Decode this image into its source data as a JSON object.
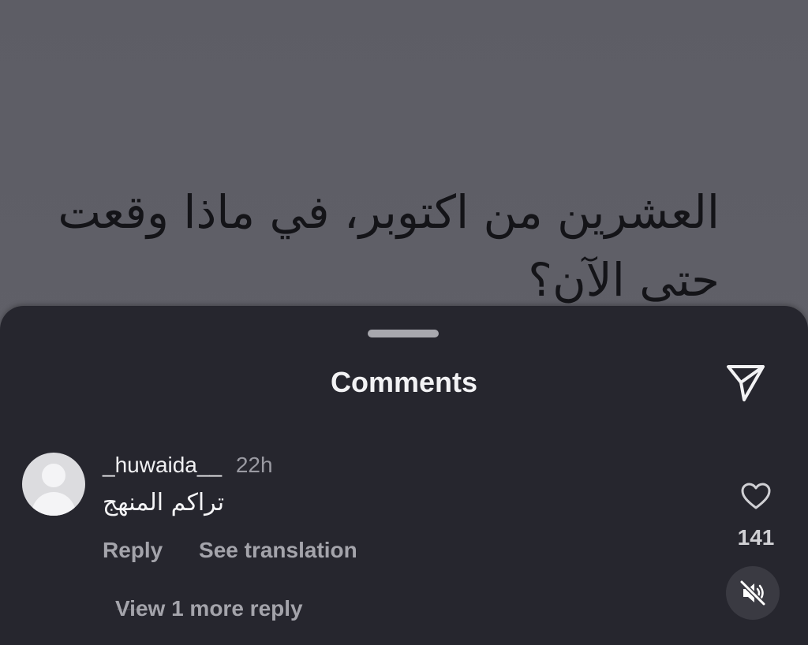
{
  "post": {
    "text_line1": "العشرين من اكتوبر، في ماذا وقعت",
    "text_line2": "حتى الآن؟"
  },
  "sheet": {
    "title": "Comments",
    "share_icon": "send-icon"
  },
  "comment": {
    "username": "_huwaida__",
    "time": "22h",
    "text": "تراكم المنهج",
    "reply_label": "Reply",
    "translate_label": "See translation",
    "view_more_label": "View 1 more reply",
    "like_icon": "heart-icon",
    "like_count": "141"
  },
  "controls": {
    "mute_icon": "muted-speaker-icon"
  }
}
